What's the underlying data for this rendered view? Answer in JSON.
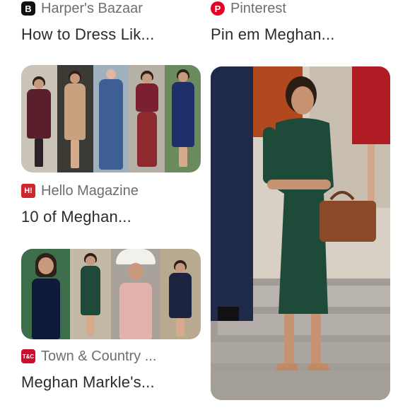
{
  "cards": [
    {
      "source": "Harper's Bazaar",
      "icon": "bazaar-b-icon",
      "icon_glyph": "B",
      "icon_color": "#111111",
      "title": "How to Dress Lik..."
    },
    {
      "source": "Pinterest",
      "icon": "pinterest-icon",
      "icon_glyph": "P",
      "icon_color": "#e60023",
      "title": "Pin em Meghan..."
    },
    {
      "source": "Hello Magazine",
      "icon": "hello-magazine-icon",
      "icon_glyph": "H!",
      "icon_color": "#d0262d",
      "title": "10 of Meghan..."
    },
    {
      "source": "Town & Country ...",
      "icon": "town-and-country-icon",
      "icon_glyph": "T&C",
      "icon_color": "#c8102e",
      "title": "Meghan Markle's..."
    }
  ]
}
